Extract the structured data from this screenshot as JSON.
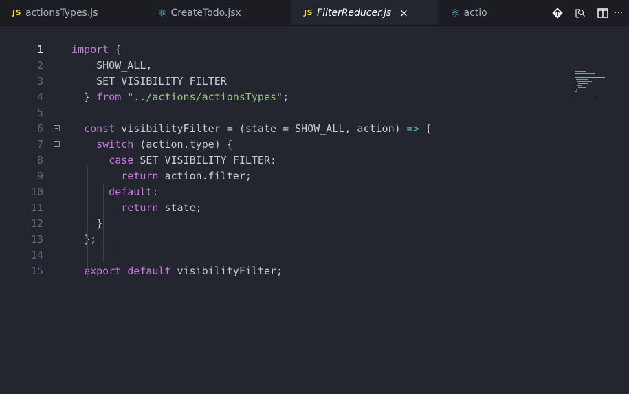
{
  "tabs": [
    {
      "icon": "JS",
      "label": "actionsTypes.js",
      "active": false
    },
    {
      "icon": "react",
      "label": "CreateTodo.jsx",
      "active": false
    },
    {
      "icon": "JS",
      "label": "FilterReducer.js",
      "active": true,
      "close": "×"
    },
    {
      "icon": "react",
      "label": "actio",
      "active": false
    }
  ],
  "toolbar": {
    "icons": [
      "git-diff-icon",
      "open-preview-icon",
      "split-editor-icon",
      "more-actions-icon"
    ],
    "more_label": "···"
  },
  "editor": {
    "current_line": 1,
    "lines": [
      {
        "n": "1",
        "tokens": [
          [
            "kw",
            "import"
          ],
          [
            "pl",
            " {"
          ]
        ]
      },
      {
        "n": "2",
        "tokens": [
          [
            "pl",
            "    SHOW_ALL,"
          ]
        ]
      },
      {
        "n": "3",
        "tokens": [
          [
            "pl",
            "    SET_VISIBILITY_FILTER"
          ]
        ]
      },
      {
        "n": "4",
        "tokens": [
          [
            "pl",
            "  } "
          ],
          [
            "kw",
            "from"
          ],
          [
            "pl",
            " "
          ],
          [
            "str",
            "\"../actions/actionsTypes\""
          ],
          [
            "pl",
            ";"
          ]
        ]
      },
      {
        "n": "5",
        "tokens": []
      },
      {
        "n": "6",
        "tokens": [
          [
            "kw",
            "  const "
          ],
          [
            "pl",
            "visibilityFilter = (state = SHOW_ALL, action) "
          ],
          [
            "op",
            "=>"
          ],
          [
            "pl",
            " {"
          ]
        ],
        "fold": true
      },
      {
        "n": "7",
        "tokens": [
          [
            "kw",
            "    switch"
          ],
          [
            "pl",
            " (action.type) {"
          ]
        ],
        "fold": true
      },
      {
        "n": "8",
        "tokens": [
          [
            "kw",
            "      case "
          ],
          [
            "pl",
            "SET_VISIBILITY_FILTER:"
          ]
        ]
      },
      {
        "n": "9",
        "tokens": [
          [
            "kw",
            "        return "
          ],
          [
            "pl",
            "action.filter;"
          ]
        ]
      },
      {
        "n": "10",
        "tokens": [
          [
            "kw",
            "      default"
          ],
          [
            "pl",
            ":"
          ]
        ]
      },
      {
        "n": "11",
        "tokens": [
          [
            "kw",
            "        return "
          ],
          [
            "pl",
            "state;"
          ]
        ]
      },
      {
        "n": "12",
        "tokens": [
          [
            "pl",
            "    }"
          ]
        ]
      },
      {
        "n": "13",
        "tokens": [
          [
            "pl",
            "  };"
          ]
        ]
      },
      {
        "n": "14",
        "tokens": []
      },
      {
        "n": "15",
        "tokens": [
          [
            "kw",
            "  export default "
          ],
          [
            "pl",
            "visibilityFilter;"
          ]
        ]
      }
    ]
  },
  "colors": {
    "keyword": "#c678dd",
    "string": "#98c379",
    "plain": "#c5cbd6",
    "js_badge": "#f5d94b",
    "react_icon": "#58c4dc",
    "background": "#23262e",
    "tabbar": "#1b1d23"
  }
}
